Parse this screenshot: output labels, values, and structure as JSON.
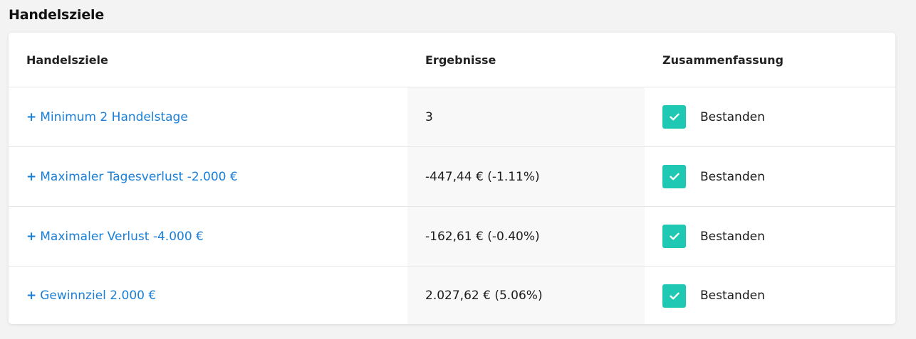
{
  "section": {
    "title": "Handelsziele"
  },
  "table": {
    "headers": {
      "goal": "Handelsziele",
      "result": "Ergebnisse",
      "summary": "Zusammenfassung"
    },
    "rows": [
      {
        "plus": "+",
        "goal": "Minimum 2 Handelstage",
        "result": "3",
        "status": "Bestanden",
        "status_icon": "check-icon"
      },
      {
        "plus": "+",
        "goal": "Maximaler Tagesverlust -2.000 €",
        "result": "-447,44 € (-1.11%)",
        "status": "Bestanden",
        "status_icon": "check-icon"
      },
      {
        "plus": "+",
        "goal": "Maximaler Verlust -4.000 €",
        "result": "-162,61 € (-0.40%)",
        "status": "Bestanden",
        "status_icon": "check-icon"
      },
      {
        "plus": "+",
        "goal": "Gewinnziel 2.000 €",
        "result": "2.027,62 € (5.06%)",
        "status": "Bestanden",
        "status_icon": "check-icon"
      }
    ]
  },
  "colors": {
    "link": "#1a7fd6",
    "success": "#1fc8b2",
    "result_bg": "#f8f8f8"
  }
}
